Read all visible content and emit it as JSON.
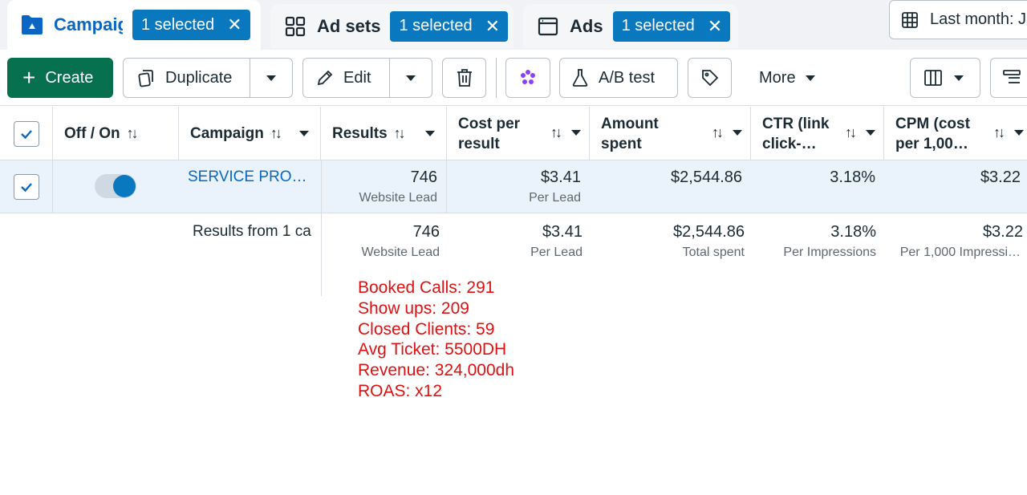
{
  "tabs": {
    "campaigns": {
      "label": "Campaigns",
      "badge": "1 selected"
    },
    "adsets": {
      "label": "Ad sets",
      "badge": "1 selected"
    },
    "ads": {
      "label": "Ads",
      "badge": "1 selected"
    }
  },
  "date_range": {
    "label": "Last month: J",
    "icon": "calendar-table-icon"
  },
  "toolbar": {
    "create_label": "Create",
    "duplicate_label": "Duplicate",
    "edit_label": "Edit",
    "ab_test_label": "A/B test",
    "more_label": "More"
  },
  "columns": {
    "off_on": "Off / On",
    "campaign": "Campaign",
    "results": "Results",
    "cost_per_result_1": "Cost per",
    "cost_per_result_2": "result",
    "amount_spent_1": "Amount",
    "amount_spent_2": "spent",
    "ctr_1": "CTR (link",
    "ctr_2": "click-…",
    "cpm_1": "CPM (cost",
    "cpm_2": "per 1,00…"
  },
  "row": {
    "campaign_name": "SERVICE PRO…",
    "results": "746",
    "results_sub": "Website Lead",
    "cost_per_result": "$3.41",
    "cost_per_result_sub": "Per Lead",
    "amount_spent": "$2,544.86",
    "ctr": "3.18%",
    "cpm": "$3.22"
  },
  "summary": {
    "label": "Results from 1 ca",
    "results": "746",
    "results_sub": "Website Lead",
    "cost_per_result": "$3.41",
    "cost_per_result_sub": "Per Lead",
    "amount_spent": "$2,544.86",
    "amount_spent_sub": "Total spent",
    "ctr": "3.18%",
    "ctr_sub": "Per Impressions",
    "cpm": "$3.22",
    "cpm_sub": "Per 1,000 Impressi…"
  },
  "notes": [
    "Booked Calls: 291",
    "Show ups: 209",
    "Closed Clients: 59",
    "Avg Ticket: 5500DH",
    "Revenue: 324,000dh",
    "ROAS: x12"
  ],
  "colors": {
    "accent": "#0a78be",
    "create_green": "#07704f",
    "link_blue": "#0a66c2",
    "note_red": "#e01010",
    "selected_row": "#eaf3fc"
  }
}
